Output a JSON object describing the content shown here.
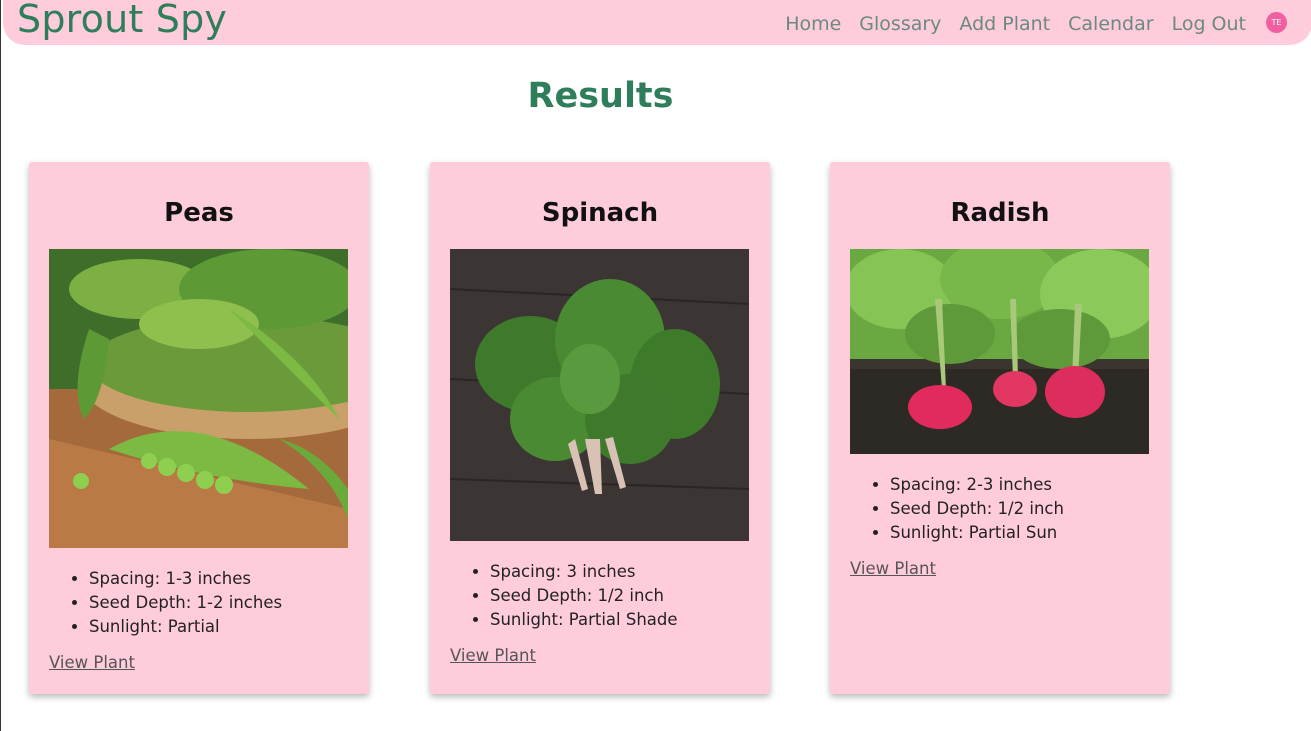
{
  "nav": {
    "brand": "Sprout Spy",
    "links": [
      "Home",
      "Glossary",
      "Add Plant",
      "Calendar",
      "Log Out"
    ],
    "avatar_initials": "TE"
  },
  "results": {
    "title": "Results",
    "cards": [
      {
        "title": "Peas",
        "image_alt": "peas-photo",
        "facts": [
          "Spacing: 1-3 inches",
          "Seed Depth: 1-2 inches",
          "Sunlight: Partial"
        ],
        "link": "View Plant"
      },
      {
        "title": "Spinach",
        "image_alt": "spinach-photo",
        "facts": [
          "Spacing: 3 inches",
          "Seed Depth: 1/2 inch",
          "Sunlight: Partial Shade"
        ],
        "link": "View Plant"
      },
      {
        "title": "Radish",
        "image_alt": "radish-photo",
        "facts": [
          "Spacing: 2-3 inches",
          "Seed Depth: 1/2 inch",
          "Sunlight: Partial Sun"
        ],
        "link": "View Plant"
      }
    ]
  },
  "colors": {
    "nav_bg": "#ffccdb",
    "brand_green": "#2e7d5b",
    "card_bg": "#ffccdb",
    "avatar_pink": "#f05f9f"
  }
}
